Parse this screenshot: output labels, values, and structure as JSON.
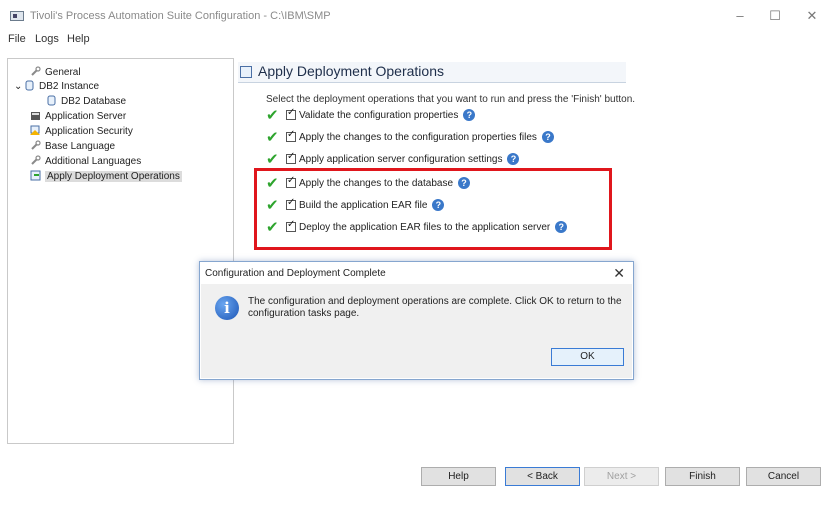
{
  "window": {
    "title": "Tivoli's Process Automation Suite Configuration - C:\\IBM\\SMP",
    "minimize": "–",
    "maximize": "☐",
    "close": "✕"
  },
  "menu": [
    "File",
    "Logs",
    "Help"
  ],
  "tree": [
    {
      "label": "General",
      "icon": "wrench-icon",
      "indent": 1
    },
    {
      "label": "DB2 Instance",
      "icon": "database-icon",
      "indent": 0,
      "expander": "⌄"
    },
    {
      "label": "DB2 Database",
      "icon": "database-icon",
      "indent": 2
    },
    {
      "label": "Application Server",
      "icon": "server-icon",
      "indent": 1
    },
    {
      "label": "Application Security",
      "icon": "security-warning-icon",
      "indent": 1
    },
    {
      "label": "Base Language",
      "icon": "wrench-icon",
      "indent": 1
    },
    {
      "label": "Additional Languages",
      "icon": "wrench-icon",
      "indent": 1
    },
    {
      "label": "Apply Deployment Operations",
      "icon": "deploy-icon",
      "indent": 1,
      "selected": true
    }
  ],
  "panel": {
    "title": "Apply Deployment Operations",
    "instructions": "Select the deployment operations that you want to run and press the 'Finish' button.",
    "operations": [
      {
        "label": "Validate the configuration properties",
        "checked": true,
        "done": true
      },
      {
        "label": "Apply the changes to the configuration properties files",
        "checked": true,
        "done": true
      },
      {
        "label": "Apply application server configuration settings",
        "checked": true,
        "done": true
      },
      {
        "label": "Apply the changes to the database",
        "checked": true,
        "done": true
      },
      {
        "label": "Build the application EAR file",
        "checked": true,
        "done": true
      },
      {
        "label": "Deploy the application EAR files to the application server",
        "checked": true,
        "done": true
      }
    ],
    "help_glyph": "?",
    "highlight_color": "#e0161c"
  },
  "dialog": {
    "title": "Configuration and Deployment Complete",
    "close": "✕",
    "icon_glyph": "i",
    "message": "The configuration and deployment operations are complete. Click OK to return to the configuration tasks page.",
    "ok_label": "OK"
  },
  "buttons": {
    "help": "Help",
    "back": "< Back",
    "next": "Next >",
    "finish": "Finish",
    "cancel": "Cancel"
  }
}
